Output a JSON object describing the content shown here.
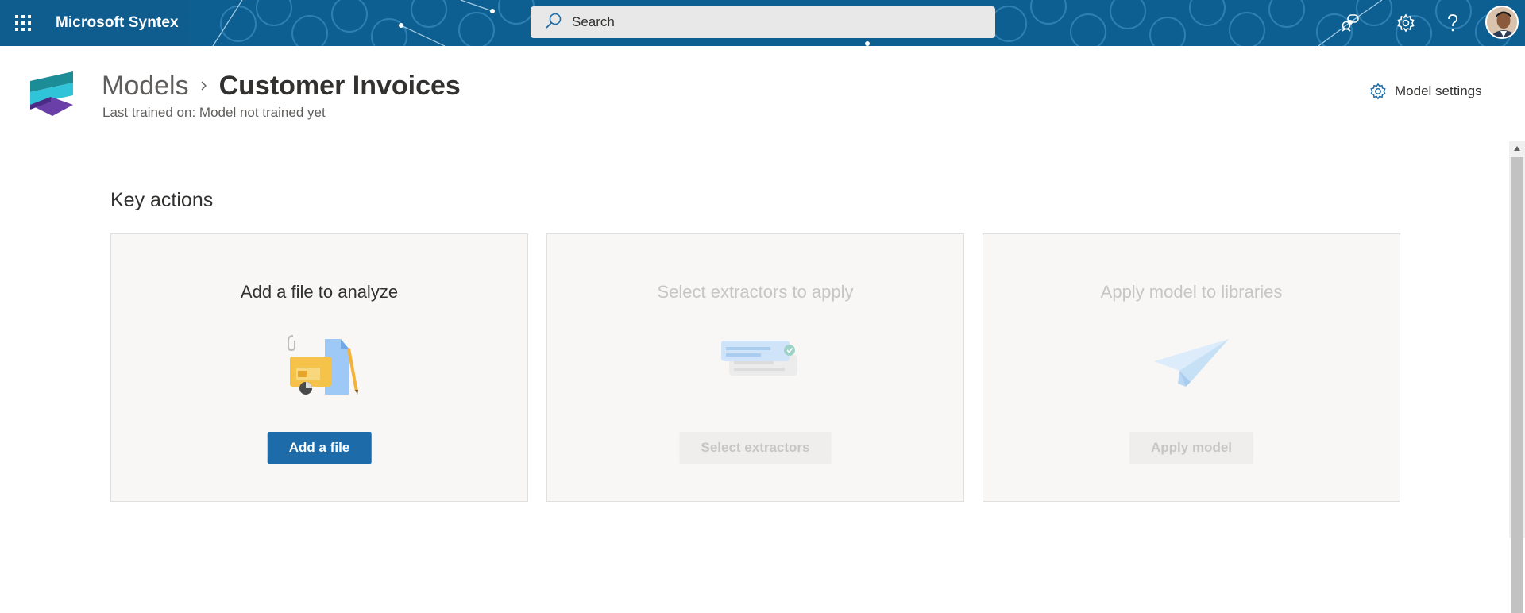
{
  "suite_bar": {
    "app_name": "Microsoft Syntex",
    "search_placeholder": "Search",
    "icons": [
      "waffle-icon",
      "search-icon",
      "chat-feedback-icon",
      "gear-icon",
      "help-icon"
    ],
    "colors": {
      "background": "#0b5c8e"
    }
  },
  "header": {
    "breadcrumb_parent": "Models",
    "breadcrumb_current": "Customer Invoices",
    "subtitle": "Last trained on: Model not trained yet",
    "model_settings_label": "Model settings"
  },
  "key_actions": {
    "title": "Key actions",
    "cards": [
      {
        "title": "Add a file to analyze",
        "button": "Add a file",
        "enabled": true,
        "icon": "files-illustration"
      },
      {
        "title": "Select extractors to apply",
        "button": "Select extractors",
        "enabled": false,
        "icon": "extractors-illustration"
      },
      {
        "title": "Apply model to libraries",
        "button": "Apply model",
        "enabled": false,
        "icon": "paper-plane-illustration"
      }
    ]
  },
  "colors": {
    "accent": "#1d6ba8",
    "disabled_text": "#c8c6c4"
  }
}
